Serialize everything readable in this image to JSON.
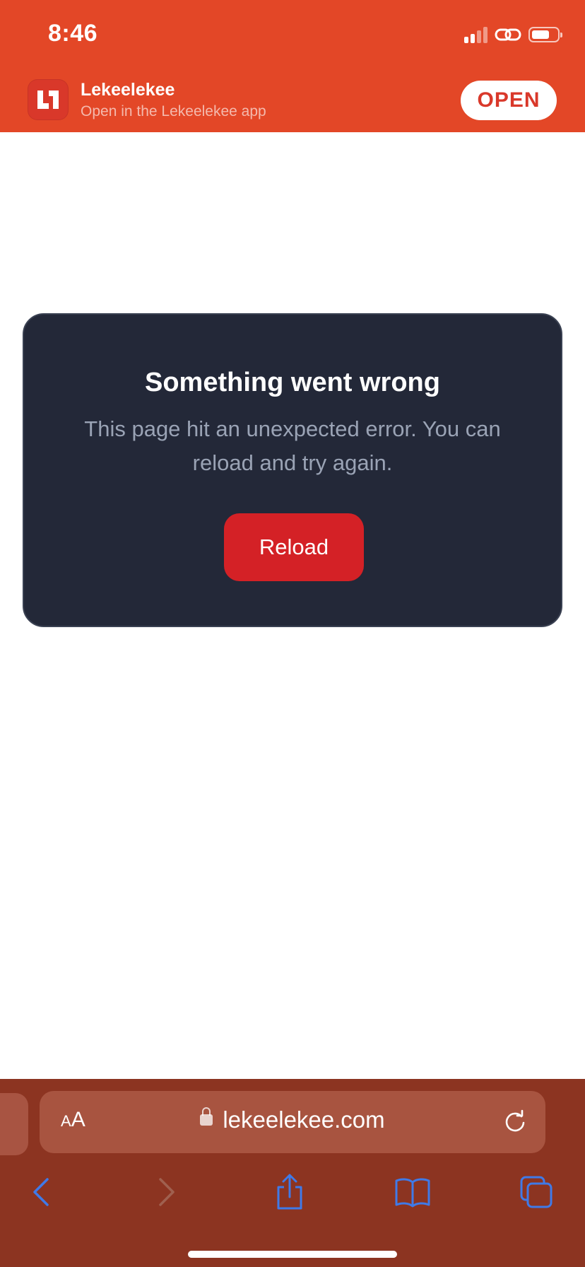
{
  "status_bar": {
    "time": "8:46"
  },
  "smart_banner": {
    "app_name": "Lekeelekee",
    "subtitle": "Open in the Lekeelekee app",
    "open_label": "OPEN"
  },
  "error_card": {
    "title": "Something went wrong",
    "message": "This page hit an unexpected error. You can reload and try again.",
    "button_label": "Reload"
  },
  "browser": {
    "text_size_label": "AA",
    "url": "lekeelekee.com"
  },
  "colors": {
    "banner": "#E34727",
    "card_bg": "#232838",
    "reload_button": "#D42126",
    "toolbar": "#8C3421",
    "toolbar_icons": "#3F7AE8"
  }
}
